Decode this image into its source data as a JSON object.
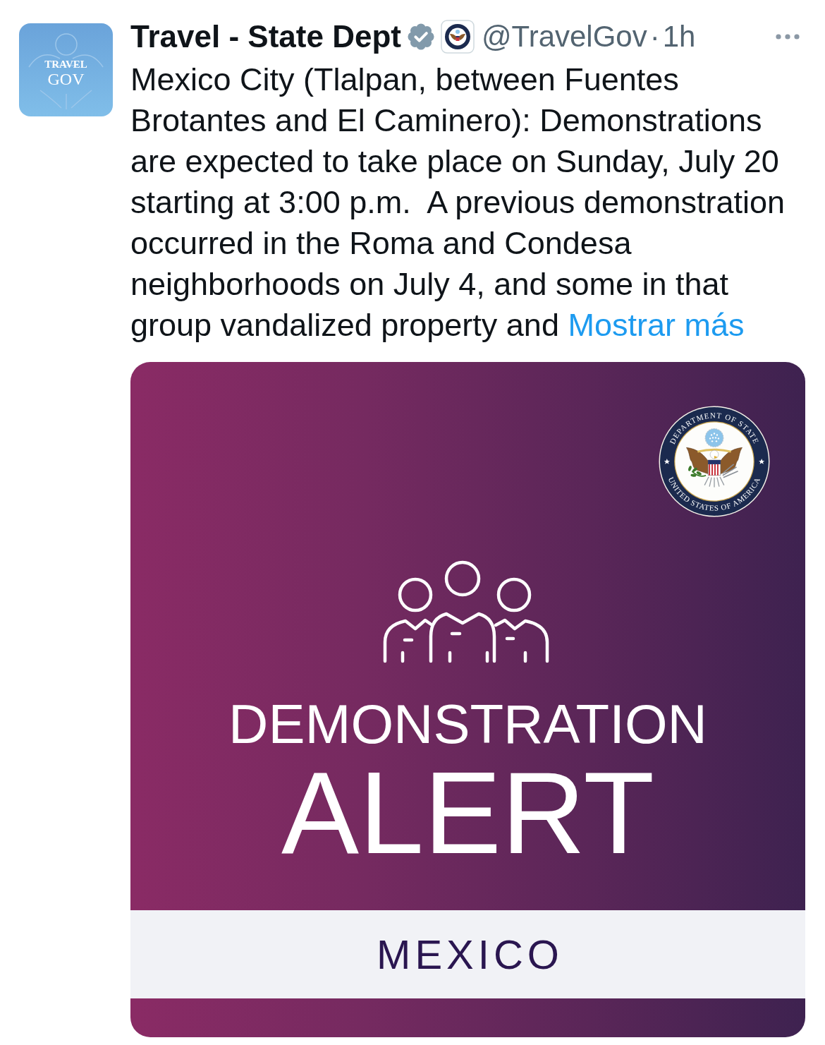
{
  "post": {
    "avatar": {
      "lines": [
        "TRAVEL",
        "GOV"
      ]
    },
    "author": {
      "name": "Travel - State Dept",
      "verified": true,
      "handle": "@TravelGov",
      "separator": "·",
      "time": "1h"
    },
    "text": "Mexico City (Tlalpan, between Fuentes Brotantes and El Caminero): Demonstrations are expected to take place on Sunday, July 20 starting at 3:00 p.m.  A previous demonstration occurred in the Roma and Condesa neighborhoods on July 4, and some in that group vandalized property and",
    "show_more": "Mostrar más",
    "media": {
      "seal_text": {
        "top": "DEPARTMENT OF STATE",
        "bottom": "UNITED STATES OF AMERICA"
      },
      "headline": "DEMONSTRATION",
      "title": "ALERT",
      "country": "MEXICO"
    }
  }
}
